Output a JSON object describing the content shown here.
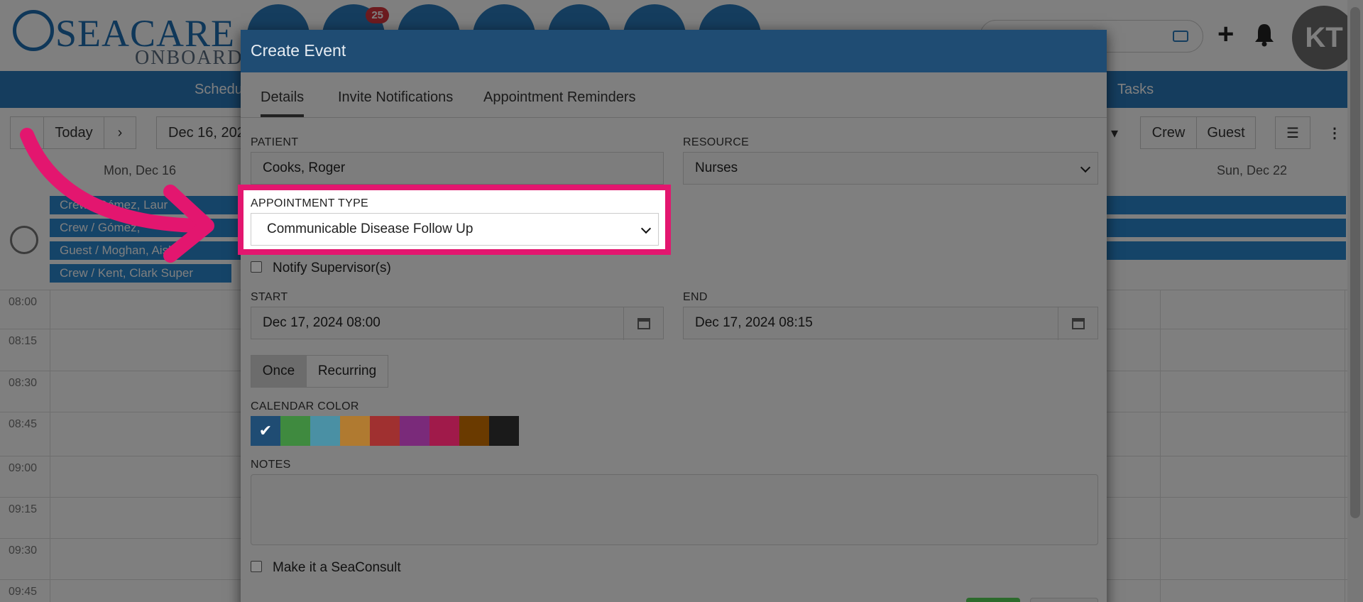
{
  "app": {
    "logo_brand_a": "SEA",
    "logo_brand_b": "CARE",
    "logo_sub": "ONBOARD",
    "notification_badge": "25",
    "avatar_initials": "KT",
    "accent_color": "#2a7bbd",
    "highlight_color": "#e3166f"
  },
  "subnav": {
    "schedule_label": "Schedu",
    "tasks_label": "Tasks"
  },
  "toolbar": {
    "prev_icon": "‹",
    "today_label": "Today",
    "next_icon": "›",
    "date_range": "Dec 16, 202",
    "crew_label": "Crew",
    "guest_label": "Guest"
  },
  "calendar": {
    "day_first": "Mon, Dec 16",
    "day_last": "Sun, Dec 22",
    "events": [
      "Crew / Gómez, Laur",
      "Crew / Gómez, ",
      "Guest / Moghan, Aisha",
      "Crew / Kent, Clark Super"
    ],
    "times": [
      "08:00",
      "08:15",
      "08:30",
      "08:45",
      "09:00",
      "09:15",
      "09:30",
      "09:45"
    ]
  },
  "modal": {
    "title": "Create Event",
    "tabs": [
      "Details",
      "Invite Notifications",
      "Appointment Reminders"
    ],
    "patient_label": "PATIENT",
    "patient_value": "Cooks, Roger",
    "resource_label": "RESOURCE",
    "resource_value": "Nurses",
    "appointment_type_label": "APPOINTMENT TYPE",
    "appointment_type_value": "Communicable Disease Follow Up",
    "notify_label": "Notify Supervisor(s)",
    "start_label": "START",
    "start_value": "Dec 17, 2024 08:00",
    "end_label": "END",
    "end_value": "Dec 17, 2024 08:15",
    "once_label": "Once",
    "recurring_label": "Recurring",
    "color_label": "CALENDAR COLOR",
    "colors": [
      "#1f4c73",
      "#3f8a3f",
      "#4a90a4",
      "#b07a30",
      "#a03030",
      "#7a2a7a",
      "#a01a4a",
      "#6a3a00",
      "#1a1a1a"
    ],
    "notes_label": "NOTES",
    "seaconsult_label": "Make it a SeaConsult"
  }
}
